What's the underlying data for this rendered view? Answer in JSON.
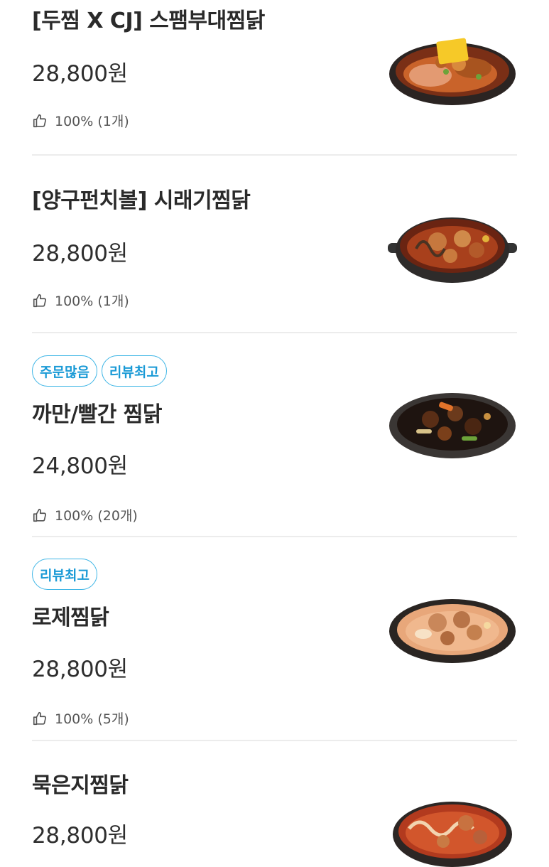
{
  "menu": {
    "items": [
      {
        "badges": [],
        "name": "[두찜 X CJ] 스팸부대찜닭",
        "price": "28,800원",
        "rating": "100% (1개)",
        "image": "spam-budae-jjimdak-image"
      },
      {
        "badges": [],
        "name": "[양구펀치볼] 시래기찜닭",
        "price": "28,800원",
        "rating": "100% (1개)",
        "image": "siraegi-jjimdak-image"
      },
      {
        "badges": [
          "주문많음",
          "리뷰최고"
        ],
        "name": "까만/빨간 찜닭",
        "price": "24,800원",
        "rating": "100% (20개)",
        "image": "black-red-jjimdak-image"
      },
      {
        "badges": [
          "리뷰최고"
        ],
        "name": "로제찜닭",
        "price": "28,800원",
        "rating": "100% (5개)",
        "image": "rose-jjimdak-image"
      },
      {
        "badges": [],
        "name": "묵은지찜닭",
        "price": "28,800원",
        "rating": "",
        "image": "mukeunji-jjimdak-image"
      }
    ],
    "badge_color": "#1a9ad6",
    "thumb_icon": "thumbs-up-icon"
  }
}
